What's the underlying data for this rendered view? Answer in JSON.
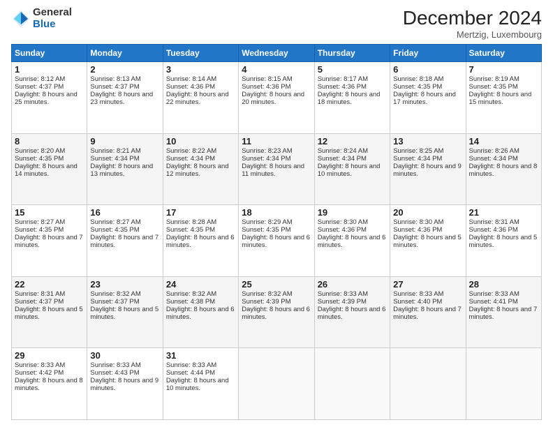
{
  "logo": {
    "general": "General",
    "blue": "Blue"
  },
  "title": "December 2024",
  "location": "Mertzig, Luxembourg",
  "days_header": [
    "Sunday",
    "Monday",
    "Tuesday",
    "Wednesday",
    "Thursday",
    "Friday",
    "Saturday"
  ],
  "weeks": [
    [
      {
        "day": "1",
        "sunrise": "Sunrise: 8:12 AM",
        "sunset": "Sunset: 4:37 PM",
        "daylight": "Daylight: 8 hours and 25 minutes."
      },
      {
        "day": "2",
        "sunrise": "Sunrise: 8:13 AM",
        "sunset": "Sunset: 4:37 PM",
        "daylight": "Daylight: 8 hours and 23 minutes."
      },
      {
        "day": "3",
        "sunrise": "Sunrise: 8:14 AM",
        "sunset": "Sunset: 4:36 PM",
        "daylight": "Daylight: 8 hours and 22 minutes."
      },
      {
        "day": "4",
        "sunrise": "Sunrise: 8:15 AM",
        "sunset": "Sunset: 4:36 PM",
        "daylight": "Daylight: 8 hours and 20 minutes."
      },
      {
        "day": "5",
        "sunrise": "Sunrise: 8:17 AM",
        "sunset": "Sunset: 4:36 PM",
        "daylight": "Daylight: 8 hours and 18 minutes."
      },
      {
        "day": "6",
        "sunrise": "Sunrise: 8:18 AM",
        "sunset": "Sunset: 4:35 PM",
        "daylight": "Daylight: 8 hours and 17 minutes."
      },
      {
        "day": "7",
        "sunrise": "Sunrise: 8:19 AM",
        "sunset": "Sunset: 4:35 PM",
        "daylight": "Daylight: 8 hours and 15 minutes."
      }
    ],
    [
      {
        "day": "8",
        "sunrise": "Sunrise: 8:20 AM",
        "sunset": "Sunset: 4:35 PM",
        "daylight": "Daylight: 8 hours and 14 minutes."
      },
      {
        "day": "9",
        "sunrise": "Sunrise: 8:21 AM",
        "sunset": "Sunset: 4:34 PM",
        "daylight": "Daylight: 8 hours and 13 minutes."
      },
      {
        "day": "10",
        "sunrise": "Sunrise: 8:22 AM",
        "sunset": "Sunset: 4:34 PM",
        "daylight": "Daylight: 8 hours and 12 minutes."
      },
      {
        "day": "11",
        "sunrise": "Sunrise: 8:23 AM",
        "sunset": "Sunset: 4:34 PM",
        "daylight": "Daylight: 8 hours and 11 minutes."
      },
      {
        "day": "12",
        "sunrise": "Sunrise: 8:24 AM",
        "sunset": "Sunset: 4:34 PM",
        "daylight": "Daylight: 8 hours and 10 minutes."
      },
      {
        "day": "13",
        "sunrise": "Sunrise: 8:25 AM",
        "sunset": "Sunset: 4:34 PM",
        "daylight": "Daylight: 8 hours and 9 minutes."
      },
      {
        "day": "14",
        "sunrise": "Sunrise: 8:26 AM",
        "sunset": "Sunset: 4:34 PM",
        "daylight": "Daylight: 8 hours and 8 minutes."
      }
    ],
    [
      {
        "day": "15",
        "sunrise": "Sunrise: 8:27 AM",
        "sunset": "Sunset: 4:35 PM",
        "daylight": "Daylight: 8 hours and 7 minutes."
      },
      {
        "day": "16",
        "sunrise": "Sunrise: 8:27 AM",
        "sunset": "Sunset: 4:35 PM",
        "daylight": "Daylight: 8 hours and 7 minutes."
      },
      {
        "day": "17",
        "sunrise": "Sunrise: 8:28 AM",
        "sunset": "Sunset: 4:35 PM",
        "daylight": "Daylight: 8 hours and 6 minutes."
      },
      {
        "day": "18",
        "sunrise": "Sunrise: 8:29 AM",
        "sunset": "Sunset: 4:35 PM",
        "daylight": "Daylight: 8 hours and 6 minutes."
      },
      {
        "day": "19",
        "sunrise": "Sunrise: 8:30 AM",
        "sunset": "Sunset: 4:36 PM",
        "daylight": "Daylight: 8 hours and 6 minutes."
      },
      {
        "day": "20",
        "sunrise": "Sunrise: 8:30 AM",
        "sunset": "Sunset: 4:36 PM",
        "daylight": "Daylight: 8 hours and 5 minutes."
      },
      {
        "day": "21",
        "sunrise": "Sunrise: 8:31 AM",
        "sunset": "Sunset: 4:36 PM",
        "daylight": "Daylight: 8 hours and 5 minutes."
      }
    ],
    [
      {
        "day": "22",
        "sunrise": "Sunrise: 8:31 AM",
        "sunset": "Sunset: 4:37 PM",
        "daylight": "Daylight: 8 hours and 5 minutes."
      },
      {
        "day": "23",
        "sunrise": "Sunrise: 8:32 AM",
        "sunset": "Sunset: 4:37 PM",
        "daylight": "Daylight: 8 hours and 5 minutes."
      },
      {
        "day": "24",
        "sunrise": "Sunrise: 8:32 AM",
        "sunset": "Sunset: 4:38 PM",
        "daylight": "Daylight: 8 hours and 6 minutes."
      },
      {
        "day": "25",
        "sunrise": "Sunrise: 8:32 AM",
        "sunset": "Sunset: 4:39 PM",
        "daylight": "Daylight: 8 hours and 6 minutes."
      },
      {
        "day": "26",
        "sunrise": "Sunrise: 8:33 AM",
        "sunset": "Sunset: 4:39 PM",
        "daylight": "Daylight: 8 hours and 6 minutes."
      },
      {
        "day": "27",
        "sunrise": "Sunrise: 8:33 AM",
        "sunset": "Sunset: 4:40 PM",
        "daylight": "Daylight: 8 hours and 7 minutes."
      },
      {
        "day": "28",
        "sunrise": "Sunrise: 8:33 AM",
        "sunset": "Sunset: 4:41 PM",
        "daylight": "Daylight: 8 hours and 7 minutes."
      }
    ],
    [
      {
        "day": "29",
        "sunrise": "Sunrise: 8:33 AM",
        "sunset": "Sunset: 4:42 PM",
        "daylight": "Daylight: 8 hours and 8 minutes."
      },
      {
        "day": "30",
        "sunrise": "Sunrise: 8:33 AM",
        "sunset": "Sunset: 4:43 PM",
        "daylight": "Daylight: 8 hours and 9 minutes."
      },
      {
        "day": "31",
        "sunrise": "Sunrise: 8:33 AM",
        "sunset": "Sunset: 4:44 PM",
        "daylight": "Daylight: 8 hours and 10 minutes."
      },
      null,
      null,
      null,
      null
    ]
  ]
}
